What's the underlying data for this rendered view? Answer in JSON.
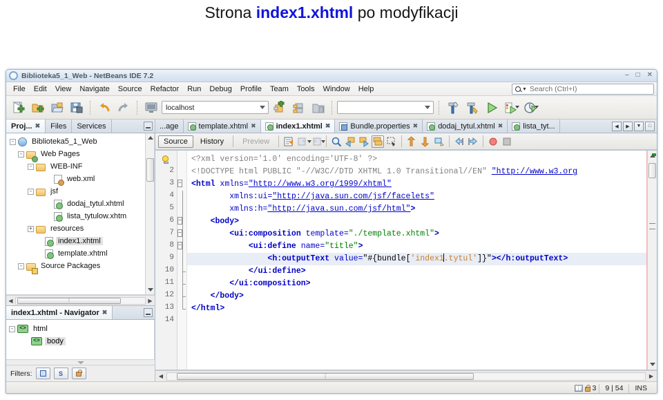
{
  "slide": {
    "title_prefix": "Strona ",
    "title_highlight": "index1.xhtml",
    "title_suffix": " po modyfikacji"
  },
  "window": {
    "title": "Biblioteka5_1_Web - NetBeans IDE 7.2",
    "minimize": "–",
    "maximize": "□",
    "close": "✕"
  },
  "menubar": {
    "items": [
      {
        "label": "File"
      },
      {
        "label": "Edit"
      },
      {
        "label": "View"
      },
      {
        "label": "Navigate"
      },
      {
        "label": "Source"
      },
      {
        "label": "Refactor"
      },
      {
        "label": "Run"
      },
      {
        "label": "Debug"
      },
      {
        "label": "Profile"
      },
      {
        "label": "Team"
      },
      {
        "label": "Tools"
      },
      {
        "label": "Window"
      },
      {
        "label": "Help"
      }
    ]
  },
  "search": {
    "placeholder": "Search (Ctrl+I)"
  },
  "toolbar": {
    "server_value": "localhost",
    "config_value": ""
  },
  "left_panel": {
    "tabs": [
      {
        "label": "Proj...",
        "active": true,
        "closeable": true
      },
      {
        "label": "Files",
        "active": false,
        "closeable": false
      },
      {
        "label": "Services",
        "active": false,
        "closeable": false
      }
    ],
    "tree": [
      {
        "label": "Biblioteka5_1_Web",
        "indent": 0,
        "expander": "-",
        "icon": "globe-icon",
        "selected": false
      },
      {
        "label": "Web Pages",
        "indent": 1,
        "expander": "-",
        "icon": "web-folder-icon",
        "selected": false
      },
      {
        "label": "WEB-INF",
        "indent": 2,
        "expander": "-",
        "icon": "folder-icon",
        "selected": false
      },
      {
        "label": "web.xml",
        "indent": 3,
        "expander": "",
        "icon": "xml-file-icon",
        "selected": false
      },
      {
        "label": "jsf",
        "indent": 2,
        "expander": "-",
        "icon": "folder-icon",
        "selected": false
      },
      {
        "label": "dodaj_tytul.xhtml",
        "indent": 3,
        "expander": "",
        "icon": "xhtml-file-icon",
        "selected": false
      },
      {
        "label": "lista_tytulow.xhtm",
        "indent": 3,
        "expander": "",
        "icon": "xhtml-file-icon",
        "selected": false
      },
      {
        "label": "resources",
        "indent": 2,
        "expander": "+",
        "icon": "folder-icon",
        "selected": false
      },
      {
        "label": "index1.xhtml",
        "indent": 2,
        "expander": "",
        "icon": "xhtml-file-icon",
        "selected": true
      },
      {
        "label": "template.xhtml",
        "indent": 2,
        "expander": "",
        "icon": "xhtml-file-icon",
        "selected": false
      },
      {
        "label": "Source Packages",
        "indent": 1,
        "expander": "-",
        "icon": "source-folder-icon",
        "selected": false
      }
    ]
  },
  "navigator": {
    "title": "index1.xhtml - Navigator",
    "nodes": [
      {
        "label": "html",
        "indent": 0,
        "expander": "-",
        "selected": false
      },
      {
        "label": "body",
        "indent": 1,
        "expander": "",
        "selected": true
      }
    ],
    "filters_label": "Filters:"
  },
  "editor_tabs": [
    {
      "label": "...age",
      "active": false,
      "closeable": false,
      "icon": "xhtml-file-icon",
      "truncated": true
    },
    {
      "label": "template.xhtml",
      "active": false,
      "closeable": true,
      "icon": "xhtml-file-icon"
    },
    {
      "label": "index1.xhtml",
      "active": true,
      "closeable": true,
      "icon": "xhtml-file-icon"
    },
    {
      "label": "Bundle.properties",
      "active": false,
      "closeable": true,
      "icon": "properties-file-icon"
    },
    {
      "label": "dodaj_tytul.xhtml",
      "active": false,
      "closeable": true,
      "icon": "xhtml-file-icon"
    },
    {
      "label": "lista_tyt...",
      "active": false,
      "closeable": false,
      "icon": "xhtml-file-icon"
    }
  ],
  "editor_toolbar": {
    "views": [
      {
        "label": "Source",
        "state": "on"
      },
      {
        "label": "History",
        "state": "normal"
      },
      {
        "label": "Preview",
        "state": "off"
      }
    ]
  },
  "code": {
    "lines": [
      {
        "num": "1",
        "marker": "bulb",
        "fold": "",
        "segments": [
          {
            "t": "<?xml version='1.0' encoding='UTF-8' ?>",
            "c": "cm"
          }
        ]
      },
      {
        "num": "2",
        "marker": "",
        "fold": "",
        "segments": [
          {
            "t": "<!DOCTYPE html PUBLIC ",
            "c": "cm"
          },
          {
            "t": "\"-//W3C//DTD XHTML 1.0 Transitional//EN\"",
            "c": "cm"
          },
          {
            "t": " ",
            "c": "cm"
          },
          {
            "t": "\"http://www.w3.org",
            "c": "url"
          }
        ]
      },
      {
        "num": "3",
        "marker": "",
        "fold": "-",
        "segments": [
          {
            "t": "<html",
            "c": "tag"
          },
          {
            "t": " xmlns=",
            "c": "attr"
          },
          {
            "t": "\"http://www.w3.org/1999/xhtml\"",
            "c": "url"
          }
        ]
      },
      {
        "num": "4",
        "marker": "",
        "fold": "|",
        "segments": [
          {
            "t": "        xmlns:ui=",
            "c": "attr"
          },
          {
            "t": "\"http://java.sun.com/jsf/facelets\"",
            "c": "url"
          }
        ]
      },
      {
        "num": "5",
        "marker": "",
        "fold": "|",
        "segments": [
          {
            "t": "        xmlns:h=",
            "c": "attr"
          },
          {
            "t": "\"http://java.sun.com/jsf/html\"",
            "c": "url"
          },
          {
            "t": ">",
            "c": "tag"
          }
        ]
      },
      {
        "num": "6",
        "marker": "",
        "fold": "-",
        "segments": [
          {
            "t": "    <body>",
            "c": "tag"
          }
        ]
      },
      {
        "num": "7",
        "marker": "",
        "fold": "-",
        "segments": [
          {
            "t": "        <ui:composition",
            "c": "tag"
          },
          {
            "t": " template=",
            "c": "attr"
          },
          {
            "t": "\"./template.xhtml\"",
            "c": "str"
          },
          {
            "t": ">",
            "c": "tag"
          }
        ]
      },
      {
        "num": "8",
        "marker": "",
        "fold": "-",
        "segments": [
          {
            "t": "            <ui:define",
            "c": "tag"
          },
          {
            "t": " name=",
            "c": "attr"
          },
          {
            "t": "\"title\"",
            "c": "str"
          },
          {
            "t": ">",
            "c": "tag"
          }
        ]
      },
      {
        "num": "9",
        "marker": "",
        "fold": "|",
        "current": true,
        "segments": [
          {
            "t": "                <h:outputText",
            "c": "tag"
          },
          {
            "t": " value=",
            "c": "attr"
          },
          {
            "t": "\"#{bundle[",
            "c": "plain"
          },
          {
            "t": "'index1",
            "c": "el"
          },
          {
            "t": "▏",
            "c": "caret"
          },
          {
            "t": ".tytul'",
            "c": "el"
          },
          {
            "t": "]}\"",
            "c": "plain"
          },
          {
            "t": "></h:outputText>",
            "c": "tag"
          }
        ]
      },
      {
        "num": "10",
        "marker": "",
        "fold": "t",
        "segments": [
          {
            "t": "            </ui:define>",
            "c": "tag"
          }
        ]
      },
      {
        "num": "11",
        "marker": "",
        "fold": "t",
        "segments": [
          {
            "t": "        </ui:composition>",
            "c": "tag"
          }
        ]
      },
      {
        "num": "12",
        "marker": "",
        "fold": "t",
        "segments": [
          {
            "t": "    </body>",
            "c": "tag"
          }
        ]
      },
      {
        "num": "13",
        "marker": "",
        "fold": "b",
        "segments": [
          {
            "t": "</html>",
            "c": "tag"
          }
        ]
      },
      {
        "num": "14",
        "marker": "",
        "fold": "",
        "segments": [
          {
            "t": "",
            "c": "plain"
          }
        ]
      }
    ]
  },
  "statusbar": {
    "memory_count": "3",
    "caret_position": "9 | 54",
    "insert_mode": "INS"
  }
}
